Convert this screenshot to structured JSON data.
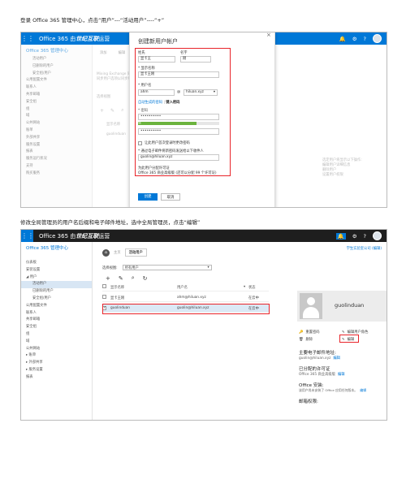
{
  "caption1": "登录 Office 365 管理中心，点击“用户”---“活动用户”----“+”",
  "caption2": "修改全局管理员的用户名后缀和电子邮件地址，选中全局管理员，点击“编辑”",
  "app_title": "Office 365 由世纪互联运营",
  "app_title_brand": "世纪互联",
  "s1": {
    "nav_heading": "Office 365 管理中心",
    "nav_items": [
      "活动用户",
      "已删除的用户",
      "安全组/用户",
      "公用配置文件",
      "联系人",
      "共享邮箱",
      "安全组",
      "组",
      "域",
      "公共网站",
      "账单",
      "外部共享",
      "服务设置",
      "报表",
      "服务运行状况",
      "支持",
      "购买服务"
    ],
    "toolbar": [
      "添加",
      "编辑"
    ],
    "bg_text": [
      "Mixing Exchange 同步: 请使用",
      "同步用户选项以同步所有活动用户"
    ],
    "bg_list": [
      "选择视图",
      "显示名称",
      "guolinduan"
    ],
    "right_panel": [
      "选定用户将显示以下操作:",
      "编辑用户详细信息",
      "删除用户",
      "设置用户权限"
    ],
    "dialog": {
      "title": "创建新用户帐户",
      "close": "×",
      "last_name_label": "姓氏",
      "first_name_label": "名字",
      "last_name": "显卡王",
      "first_name": "刚",
      "display_name_label": "* 显示名称",
      "display_name": "显卡王刚",
      "username_label": "* 用户名",
      "username": "ahm",
      "at": "@",
      "domain": "hiluan.xyz",
      "auto_pw": "自动生成的密码",
      "manual_pw": "键入密码",
      "pw_label": "* 密码",
      "pw1": "••••••••••",
      "strength": "强",
      "pw2": "••••••••••",
      "require_change": "让此用户首次登录时更改密码",
      "email_label": "* 通过电子邮件将新密码发送给以下收件人",
      "email": "guolin@hiluan.xyz",
      "lic_text1": "为此用户分配许可证",
      "lic_text2": "Office 365 商业高级版 (还可以分配 99 个许可证)",
      "create": "创建",
      "cancel": "取消"
    }
  },
  "s2": {
    "nav_heading": "Office 365 管理中心",
    "nav_items": [
      "仪表板",
      "安装设置",
      "用户",
      "活动用户",
      "已删除的用户",
      "安全组/用户",
      "公用配置文件",
      "联系人",
      "共享邮箱",
      "安全组",
      "组",
      "域",
      "公共网站",
      "账单",
      "外部共享",
      "服务设置",
      "报表"
    ],
    "company": "学生实验室公司 (编辑)",
    "page_tab": "活动用户",
    "view_label": "选择视图:",
    "view_value": "所有用户",
    "toolbar_icons": [
      "+",
      "✎",
      "⌕",
      "↻"
    ],
    "columns": [
      "显示名称",
      "用户名",
      "状态"
    ],
    "rows": [
      {
        "name": "显卡王刚",
        "user": "ahm@hiluan.xyz",
        "status": "在云中"
      },
      {
        "name": "guolinduan",
        "user": "guolin@hiluan.xyz",
        "status": "在云中"
      }
    ],
    "detail": {
      "name": "guolinduan",
      "reset_pw": "重置密码",
      "edit_role": "编辑用户角色",
      "delete": "删除",
      "edit": "编辑",
      "email_title": "主要电子邮件地址:",
      "email_value": "guolin@hiluan.xyz",
      "email_edit": "编辑",
      "license_title": "已分配的许可证",
      "license_value": "Office 365 商业高级版",
      "license_edit": "编辑",
      "install_title": "Office 安装:",
      "install_value": "该用户尚未安装了 Office 应用任何版本。",
      "install_edit": "编辑",
      "mailbox_title": "邮箱权限:"
    }
  }
}
